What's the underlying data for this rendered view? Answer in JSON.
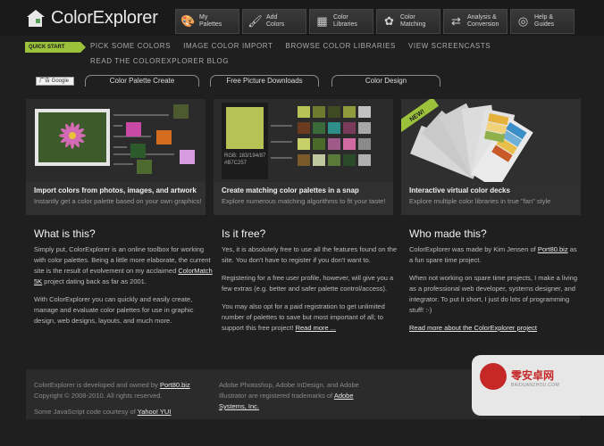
{
  "app": {
    "title": "ColorExplorer"
  },
  "topnav": [
    {
      "label": "My\nPalettes",
      "icon": "palette-icon",
      "glyph": "🎨"
    },
    {
      "label": "Add\nColors",
      "icon": "brush-icon",
      "glyph": "🖌"
    },
    {
      "label": "Color\nLibraries",
      "icon": "library-icon",
      "glyph": "▦"
    },
    {
      "label": "Color\nMatching",
      "icon": "color-wheel-icon",
      "glyph": "✿"
    },
    {
      "label": "Analysis &\nConversion",
      "icon": "convert-icon",
      "glyph": "⇄"
    },
    {
      "label": "Help &\nGuides",
      "icon": "lifebuoy-icon",
      "glyph": "◎"
    }
  ],
  "subnav": {
    "quick_start": "QUICK START",
    "links": [
      "PICK SOME COLORS",
      "IMAGE COLOR IMPORT",
      "BROWSE COLOR LIBRARIES",
      "VIEW SCREENCASTS"
    ],
    "blog": "READ THE COLOREXPLORER BLOG"
  },
  "google_button": "广告 Google",
  "pills": [
    "Color Palette Create",
    "Free Picture Downloads",
    "Color Design"
  ],
  "panels": [
    {
      "title": "Import colors from photos, images, and artwork",
      "desc": "Instantly get a color palette based on your own graphics!"
    },
    {
      "title": "Create matching color palettes in a snap",
      "desc": "Explore numerous matching algorithms to fit your taste!",
      "swatch_rgb": "RGB: 183/194/87",
      "swatch_hex": "#B7C257"
    },
    {
      "title": "Interactive virtual color decks",
      "desc": "Explore multiple color libraries in true \"fan\" style",
      "badge": "NEW!"
    }
  ],
  "what": {
    "heading": "What is this?",
    "p1": "Simply put, ColorExplorer is an online toolbox for working with color palettes. Being a little more elaborate, the current site is the result of evolvement on my acclaimed",
    "p1_link": "ColorMatch 5K",
    "p1_tail": " project dating back as far as 2001.",
    "p2": "With ColorExplorer you can quickly and easily create, manage and evaluate color palettes for use in graphic design, web designs, layouts, and much more."
  },
  "free": {
    "heading": "Is it free?",
    "p1": "Yes, it is absolutely free to use all the features found on the site. You don't have to register if you don't want to.",
    "p2": "Registering for a free user profile, however, will give you a few extras (e.g. better and safer palette control/access).",
    "p3": "You may also opt for a paid registration to get unlimited number of palettes to save but most important of all; to support this free project!",
    "p3_link": "Read more ..."
  },
  "who": {
    "heading": "Who made this?",
    "p1": "ColorExplorer was made by Kim Jensen of",
    "p1_link": "Port80.biz",
    "p1_tail": "as a fun spare time project.",
    "p2": "When not working on spare time projects, I make a living as a professional web developer, systems designer, and integrator. To put it short, I just do lots of programming stuff! :-)",
    "p3_link": "Read more about the ColorExplorer project"
  },
  "footer": {
    "l1": "ColorExplorer is developed and owned by",
    "l1_link": "Port80.biz",
    "l2": "Copyright © 2008-2010. All rights reserved.",
    "l3": "Some JavaScript code courtesy of",
    "l3_link": "Yahoo! YUI",
    "r1": "Adobe Photoshop, Adobe InDesign, and Adobe Illustrator are registered trademarks of",
    "r1_link": "Adobe Systems, Inc."
  },
  "watermark": {
    "text": "零安卓网",
    "sub": "BAIDUANZHOU.COM"
  },
  "colors": {
    "accent": "#9cc23c",
    "swatch": "#b7c257",
    "bg": "#1f1f1f"
  }
}
